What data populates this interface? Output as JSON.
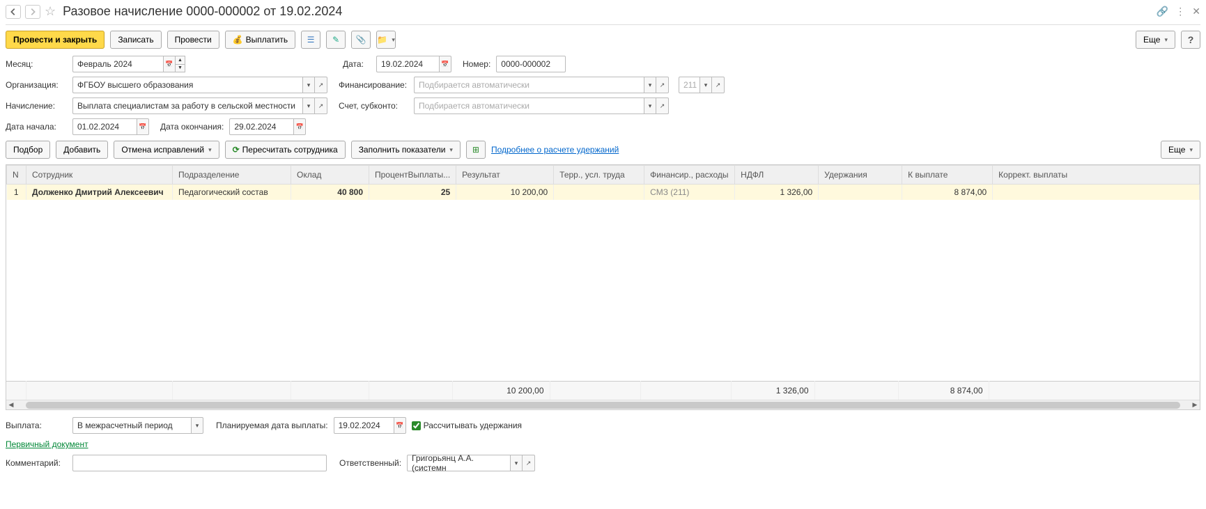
{
  "header": {
    "title": "Разовое начисление 0000-000002 от 19.02.2024"
  },
  "toolbar": {
    "post_close": "Провести и закрыть",
    "save": "Записать",
    "post": "Провести",
    "pay": "Выплатить",
    "more": "Еще"
  },
  "fields": {
    "month_label": "Месяц:",
    "month_value": "Февраль 2024",
    "date_label": "Дата:",
    "date_value": "19.02.2024",
    "number_label": "Номер:",
    "number_value": "0000-000002",
    "org_label": "Организация:",
    "org_value": "ФГБОУ высшего образования",
    "financing_label": "Финансирование:",
    "financing_placeholder": "Подбирается автоматически",
    "code_value": "211",
    "accrual_label": "Начисление:",
    "accrual_value": "Выплата специалистам за работу в сельской местности",
    "account_label": "Счет, субконто:",
    "account_placeholder": "Подбирается автоматически",
    "start_label": "Дата начала:",
    "start_value": "01.02.2024",
    "end_label": "Дата окончания:",
    "end_value": "29.02.2024"
  },
  "midbar": {
    "pick": "Подбор",
    "add": "Добавить",
    "cancel_fixes": "Отмена исправлений",
    "recalc": "Пересчитать сотрудника",
    "fill_ind": "Заполнить показатели",
    "more_link": "Подробнее о расчете удержаний",
    "more": "Еще"
  },
  "table": {
    "headers": {
      "n": "N",
      "employee": "Сотрудник",
      "dept": "Подразделение",
      "salary": "Оклад",
      "percent": "ПроцентВыплаты...",
      "result": "Результат",
      "terr": "Терр., усл. труда",
      "fin": "Финансир., расходы",
      "ndfl": "НДФЛ",
      "withhold": "Удержания",
      "topay": "К выплате",
      "corr": "Коррект. выплаты"
    },
    "rows": [
      {
        "n": "1",
        "employee": "Долженко Дмитрий Алексеевич",
        "dept": "Педагогический состав",
        "salary": "40 800",
        "percent": "25",
        "result": "10 200,00",
        "terr": "",
        "fin": "СМЗ (211)",
        "ndfl": "1 326,00",
        "withhold": "",
        "topay": "8 874,00",
        "corr": ""
      }
    ],
    "totals": {
      "result": "10 200,00",
      "ndfl": "1 326,00",
      "topay": "8 874,00"
    }
  },
  "footer": {
    "payout_label": "Выплата:",
    "payout_value": "В межрасчетный период",
    "planned_label": "Планируемая дата выплаты:",
    "planned_value": "19.02.2024",
    "calc_withhold": "Рассчитывать удержания",
    "primary_doc": "Первичный документ",
    "comment_label": "Комментарий:",
    "comment_value": "",
    "responsible_label": "Ответственный:",
    "responsible_value": "Григорьянц А.А. (системн"
  }
}
